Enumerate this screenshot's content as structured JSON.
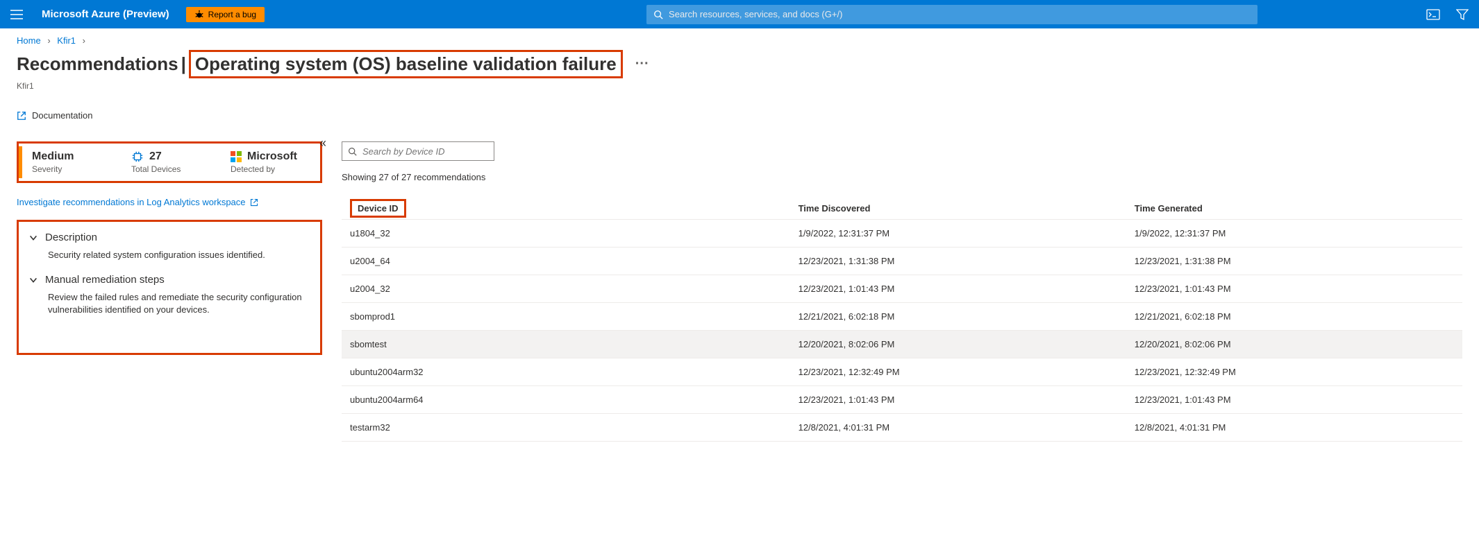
{
  "topbar": {
    "brand": "Microsoft Azure (Preview)",
    "report_bug": "Report a bug",
    "search_placeholder": "Search resources, services, and docs (G+/)"
  },
  "breadcrumb": {
    "home": "Home",
    "item": "Kfir1"
  },
  "page": {
    "title_prefix": "Recommendations",
    "title_sep": "|",
    "title_main": "Operating system (OS) baseline validation failure",
    "subscription": "Kfir1",
    "documentation": "Documentation"
  },
  "stats": {
    "severity_value": "Medium",
    "severity_label": "Severity",
    "devices_value": "27",
    "devices_label": "Total Devices",
    "detected_value": "Microsoft",
    "detected_label": "Detected by"
  },
  "investigate_link": "Investigate recommendations in Log Analytics workspace",
  "sections": {
    "description_title": "Description",
    "description_body": "Security related system configuration issues identified.",
    "remediation_title": "Manual remediation steps",
    "remediation_body": "Review the failed rules and remediate the security configuration vulnerabilities identified on your devices."
  },
  "right": {
    "device_search_placeholder": "Search by Device ID",
    "showing": "Showing 27 of 27 recommendations",
    "columns": {
      "device_id": "Device ID",
      "time_discovered": "Time Discovered",
      "time_generated": "Time Generated"
    },
    "rows": [
      {
        "device": "u1804_32",
        "discovered": "1/9/2022, 12:31:37 PM",
        "generated": "1/9/2022, 12:31:37 PM",
        "hl": false
      },
      {
        "device": "u2004_64",
        "discovered": "12/23/2021, 1:31:38 PM",
        "generated": "12/23/2021, 1:31:38 PM",
        "hl": false
      },
      {
        "device": "u2004_32",
        "discovered": "12/23/2021, 1:01:43 PM",
        "generated": "12/23/2021, 1:01:43 PM",
        "hl": false
      },
      {
        "device": "sbomprod1",
        "discovered": "12/21/2021, 6:02:18 PM",
        "generated": "12/21/2021, 6:02:18 PM",
        "hl": false
      },
      {
        "device": "sbomtest",
        "discovered": "12/20/2021, 8:02:06 PM",
        "generated": "12/20/2021, 8:02:06 PM",
        "hl": true
      },
      {
        "device": "ubuntu2004arm32",
        "discovered": "12/23/2021, 12:32:49 PM",
        "generated": "12/23/2021, 12:32:49 PM",
        "hl": false
      },
      {
        "device": "ubuntu2004arm64",
        "discovered": "12/23/2021, 1:01:43 PM",
        "generated": "12/23/2021, 1:01:43 PM",
        "hl": false
      },
      {
        "device": "testarm32",
        "discovered": "12/8/2021, 4:01:31 PM",
        "generated": "12/8/2021, 4:01:31 PM",
        "hl": false
      }
    ]
  }
}
